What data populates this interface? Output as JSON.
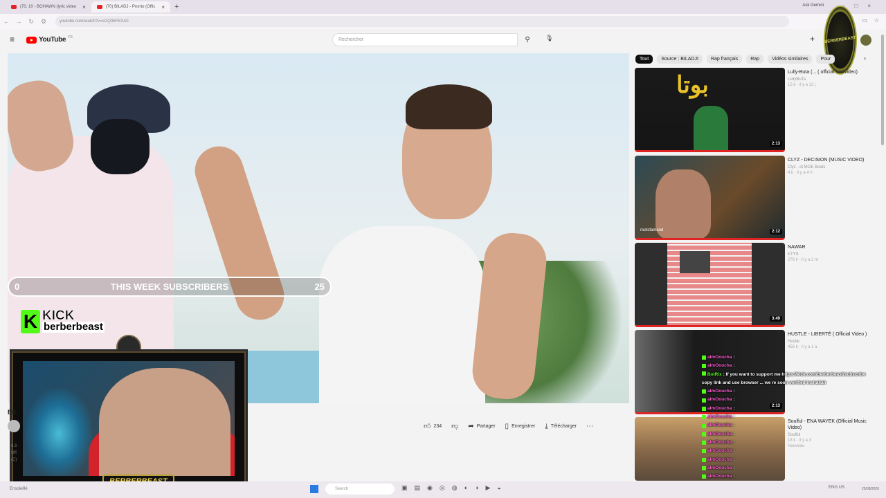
{
  "browser": {
    "tabs": [
      {
        "label": "(70, 10 - BOHAWN (lyric video"
      },
      {
        "label": "(70) BILADJ - Pronto (Offic"
      }
    ],
    "new_tab": "+",
    "gemini": "Ask Gemini",
    "url": "youtube.com/watch?v=sOQ0bFEXA0"
  },
  "youtube": {
    "logo_text": "YouTube",
    "logo_cc": "FR",
    "search_placeholder": "Rechercher"
  },
  "overlay": {
    "subs_left": "0",
    "subs_label": "THIS WEEK SUBSCRIBERS",
    "subs_right": "25",
    "kick_brand": "KICK",
    "kick_user": "berberbeast",
    "bb_tag": "BERBERBEAST",
    "corner_logo": "BERBERBEAST"
  },
  "video": {
    "title_fragment": "BIL",
    "meta_lines": [
      "6.6",
      "Off",
      "(C)"
    ],
    "actions": {
      "like_count": "234",
      "share": "Partager",
      "save": "Enregistrer",
      "download": "Télécharger"
    }
  },
  "chips": [
    "Tout",
    "Source : BILADJI",
    "Rap français",
    "Rap",
    "Vidéos similaires",
    "Pour"
  ],
  "recommendations": [
    {
      "title": "Lully-Buta (... ( official ...ic video)",
      "channel": "LullyBuTa",
      "meta": "15 k · il y a 12 j",
      "duration": "2:13"
    },
    {
      "title": "CLYZ - DECISION (MUSIC VIDEO)",
      "channel": "Clyz · et MOE Beats",
      "meta": "4 k · il y a 4 h",
      "duration": "2:12",
      "watermark": "rootstamand"
    },
    {
      "title": "NAWAR",
      "channel": "KTYS",
      "meta": "276 k · il y a 2 m",
      "duration": "3:49"
    },
    {
      "title": "HUSTLE - LIBERTÉ ( Official Video )",
      "channel": "Hustle",
      "meta": "456 k · il y a 1 a",
      "duration": "2:13"
    },
    {
      "title": "Soulful - ENA WAYEK (Official Music Video)",
      "channel": "Soulful",
      "meta": "18 k · il y a 3",
      "duration": "",
      "badge": "Nouveau"
    }
  ],
  "chat": [
    {
      "name": "almOoucha",
      "msg": ""
    },
    {
      "name": "almOoucha",
      "msg": ""
    },
    {
      "name": "BotRix",
      "msg": "If you want to support me https://kick.com/berberbeast/subscribe copy link and use browser ... we re soon verified inshallah",
      "bot": true
    },
    {
      "name": "almOoucha",
      "msg": ""
    },
    {
      "name": "almOoucha",
      "msg": ""
    },
    {
      "name": "almOoucha",
      "msg": ""
    },
    {
      "name": "almOoucha",
      "msg": ""
    },
    {
      "name": "almOoucha",
      "msg": ""
    },
    {
      "name": "almOoucha",
      "msg": ""
    },
    {
      "name": "almOoucha",
      "msg": ""
    },
    {
      "name": "almOoucha",
      "msg": ""
    },
    {
      "name": "almOoucha",
      "msg": ""
    },
    {
      "name": "almOoucha",
      "msg": ""
    },
    {
      "name": "almOoucha",
      "msg": ""
    },
    {
      "name": "almOoucha",
      "msg": ""
    }
  ],
  "taskbar": {
    "weather": "Ensoleillé",
    "search": "Search",
    "tray": "ENG US",
    "clock": "25/08/2026"
  },
  "colors": {
    "kick_green": "#53fc18",
    "yt_red": "#ff0000",
    "chat_name": "#ff5fd2"
  }
}
